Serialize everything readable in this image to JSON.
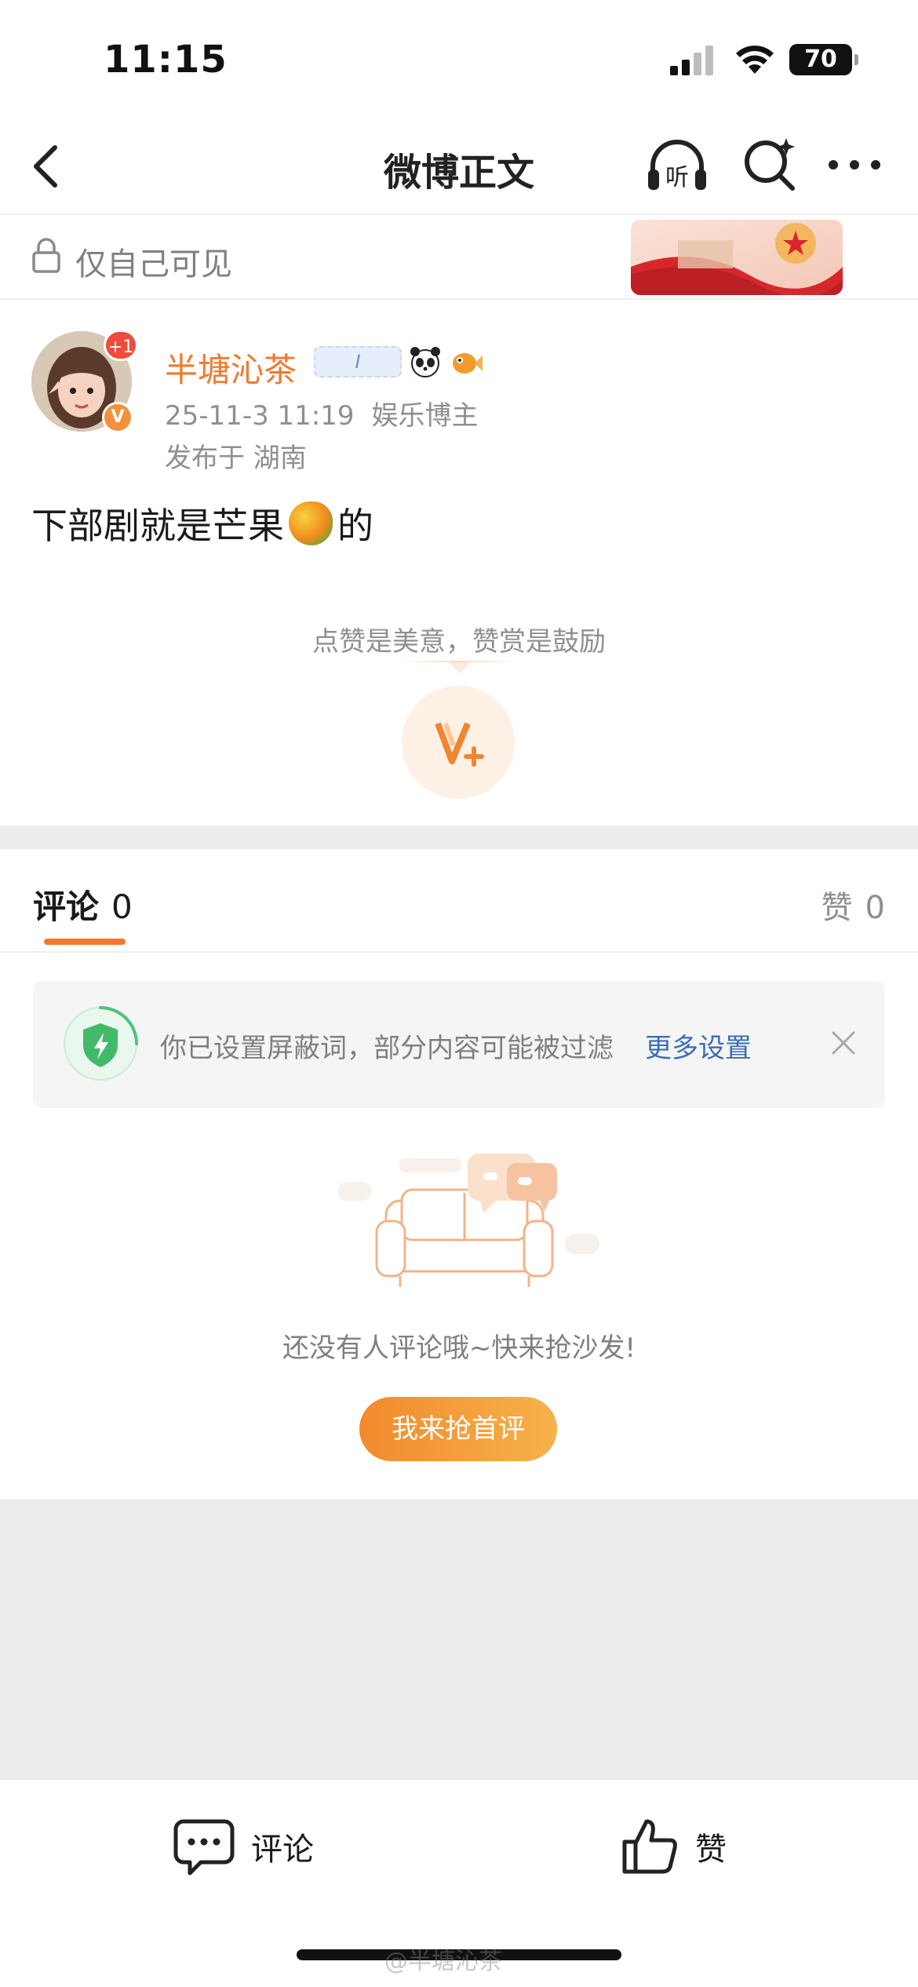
{
  "status_bar": {
    "time": "11:15",
    "battery": "70",
    "icons": [
      "signal-icon",
      "wifi-icon",
      "battery-icon"
    ]
  },
  "nav": {
    "title": "微博正文",
    "listen_label": "听",
    "icons": [
      "back-arrow-icon",
      "listen-headphones-icon",
      "search-sparkle-icon",
      "more-icon"
    ]
  },
  "visibility": {
    "text": "仅自己可见",
    "icon": "lock-icon"
  },
  "post": {
    "author": {
      "name": "半塘沁茶",
      "avatar_badge": "+1",
      "verified_badge": "V",
      "emoji_badge_text": "I"
    },
    "timestamp": "25-11-3 11:19",
    "author_role": "娱乐博主",
    "location": "发布于 湖南",
    "text_before": "下部剧就是芒果",
    "text_after": "的",
    "inline_emoji": "mango-emoji"
  },
  "reward": {
    "tip": "点赞是美意，赞赏是鼓励",
    "icon": "reward-v-plus-icon"
  },
  "tabs": {
    "comments_label": "评论",
    "comments_count": "0",
    "likes_label": "赞",
    "likes_count": "0"
  },
  "notice": {
    "text": "你已设置屏蔽词，部分内容可能被过滤",
    "link": "更多设置",
    "icons": [
      "shield-icon",
      "close-icon"
    ]
  },
  "empty_state": {
    "text": "还没有人评论哦~快来抢沙发!",
    "button": "我来抢首评",
    "illustration": "sofa-chat-illustration"
  },
  "bottom_bar": {
    "comment_label": "评论",
    "like_label": "赞",
    "icons": [
      "comment-icon",
      "thumbs-up-icon"
    ]
  },
  "watermark": "@半塘沁茶",
  "colors": {
    "accent": "#f07a2e",
    "link": "#3d6cb4",
    "muted": "#8f8f8f",
    "gap": "#ececec"
  }
}
